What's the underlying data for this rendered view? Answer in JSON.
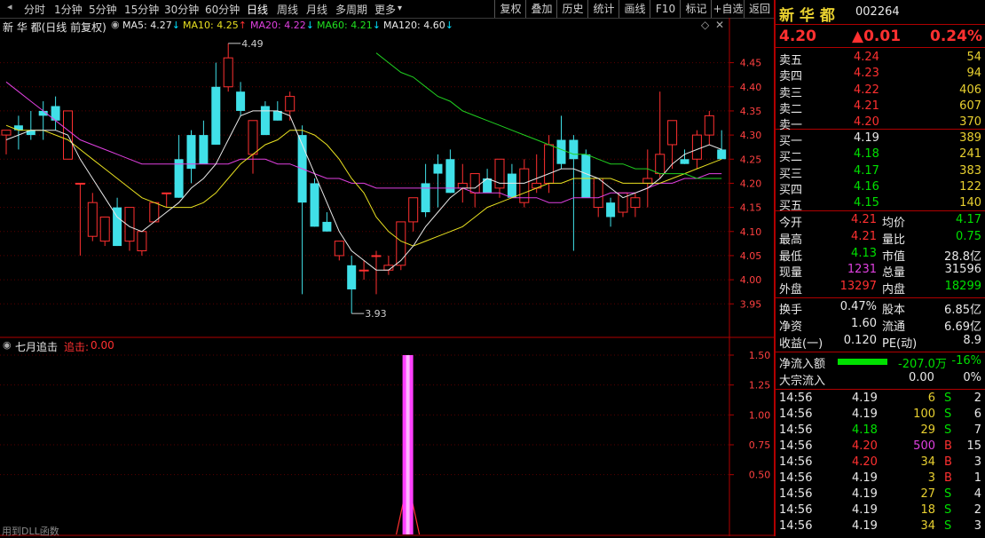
{
  "toolbar": {
    "periods": [
      "分时",
      "1分钟",
      "5分钟",
      "15分钟",
      "30分钟",
      "60分钟",
      "日线",
      "周线",
      "月线",
      "多周期",
      "更多"
    ],
    "active_period": "日线",
    "more_arrow": "▾",
    "right_buttons": [
      "复权",
      "叠加",
      "历史",
      "统计",
      "画线",
      "F10",
      "标记",
      "+自选",
      "返回"
    ]
  },
  "main_chart": {
    "title": "新 华 都(日线 前复权)",
    "ma_labels": [
      {
        "text": "MA5: 4.27",
        "arrow": "↓",
        "color": "#e8e8e8"
      },
      {
        "text": "MA10: 4.25",
        "arrow": "↑",
        "color": "#e8e020"
      },
      {
        "text": "MA20: 4.22",
        "arrow": "↓",
        "color": "#e040e0"
      },
      {
        "text": "MA60: 4.21",
        "arrow": "↓",
        "color": "#20e020"
      },
      {
        "text": "MA120: 4.60",
        "arrow": "↓",
        "color": "#e8e8e8"
      }
    ],
    "high_marker": "4.49",
    "low_marker": "3.93",
    "price_ticks": [
      "4.45",
      "4.40",
      "4.35",
      "4.30",
      "4.25",
      "4.20",
      "4.15",
      "4.10",
      "4.05",
      "4.00",
      "3.95"
    ]
  },
  "chart_data": {
    "type": "candlestick",
    "ylim": [
      3.91,
      4.51
    ],
    "candles": [
      [
        4.3,
        4.31,
        4.26,
        4.31
      ],
      [
        4.32,
        4.34,
        4.27,
        4.31
      ],
      [
        4.31,
        4.35,
        4.29,
        4.3
      ],
      [
        4.35,
        4.37,
        4.29,
        4.34
      ],
      [
        4.36,
        4.38,
        4.31,
        4.33
      ],
      [
        4.25,
        4.35,
        4.25,
        4.35
      ],
      [
        4.2,
        4.2,
        4.05,
        4.2
      ],
      [
        4.09,
        4.18,
        4.08,
        4.16
      ],
      [
        4.08,
        4.12,
        4.07,
        4.13
      ],
      [
        4.15,
        4.17,
        4.07,
        4.07
      ],
      [
        4.08,
        4.13,
        4.06,
        4.15
      ],
      [
        4.06,
        4.1,
        4.05,
        4.1
      ],
      [
        4.12,
        4.16,
        4.12,
        4.16
      ],
      [
        4.18,
        4.18,
        4.15,
        4.18
      ],
      [
        4.25,
        4.3,
        4.17,
        4.17
      ],
      [
        4.3,
        4.31,
        4.2,
        4.23
      ],
      [
        4.3,
        4.33,
        4.24,
        4.24
      ],
      [
        4.4,
        4.45,
        4.28,
        4.28
      ],
      [
        4.4,
        4.49,
        4.39,
        4.46
      ],
      [
        4.39,
        4.41,
        4.34,
        4.35
      ],
      [
        4.26,
        4.33,
        4.22,
        4.33
      ],
      [
        4.36,
        4.37,
        4.3,
        4.3
      ],
      [
        4.35,
        4.37,
        4.33,
        4.33
      ],
      [
        4.35,
        4.39,
        4.33,
        4.38
      ],
      [
        4.3,
        4.32,
        3.97,
        4.16
      ],
      [
        4.2,
        4.21,
        4.11,
        4.11
      ],
      [
        4.12,
        4.14,
        4.1,
        4.1
      ],
      [
        4.05,
        4.08,
        4.04,
        4.08
      ],
      [
        4.03,
        4.05,
        3.93,
        3.98
      ],
      [
        4.02,
        4.04,
        4.0,
        4.02
      ],
      [
        4.05,
        4.06,
        3.97,
        4.05
      ],
      [
        4.02,
        4.05,
        4.01,
        4.03
      ],
      [
        4.03,
        4.11,
        4.02,
        4.12
      ],
      [
        4.12,
        4.17,
        4.1,
        4.17
      ],
      [
        4.2,
        4.24,
        4.13,
        4.14
      ],
      [
        4.24,
        4.26,
        4.15,
        4.22
      ],
      [
        4.25,
        4.27,
        4.18,
        4.18
      ],
      [
        4.19,
        4.24,
        4.16,
        4.2
      ],
      [
        4.18,
        4.22,
        4.15,
        4.22
      ],
      [
        4.21,
        4.23,
        4.18,
        4.18
      ],
      [
        4.19,
        4.25,
        4.17,
        4.25
      ],
      [
        4.22,
        4.24,
        4.17,
        4.17
      ],
      [
        4.16,
        4.25,
        4.15,
        4.23
      ],
      [
        4.19,
        4.26,
        4.18,
        4.2
      ],
      [
        4.2,
        4.3,
        4.18,
        4.28
      ],
      [
        4.29,
        4.34,
        4.23,
        4.24
      ],
      [
        4.29,
        4.3,
        4.06,
        4.25
      ],
      [
        4.26,
        4.27,
        4.17,
        4.17
      ],
      [
        4.15,
        4.18,
        4.13,
        4.21
      ],
      [
        4.16,
        4.17,
        4.11,
        4.13
      ],
      [
        4.14,
        4.18,
        4.13,
        4.18
      ],
      [
        4.15,
        4.18,
        4.13,
        4.17
      ],
      [
        4.2,
        4.27,
        4.15,
        4.21
      ],
      [
        4.22,
        4.39,
        4.21,
        4.26
      ],
      [
        4.28,
        4.33,
        4.23,
        4.33
      ],
      [
        4.25,
        4.27,
        4.24,
        4.24
      ],
      [
        4.25,
        4.31,
        4.23,
        4.3
      ],
      [
        4.3,
        4.35,
        4.28,
        4.34
      ],
      [
        4.27,
        4.31,
        4.26,
        4.25
      ]
    ],
    "ma5": [
      4.29,
      4.3,
      4.31,
      4.31,
      4.31,
      4.3,
      4.25,
      4.21,
      4.17,
      4.13,
      4.11,
      4.1,
      4.12,
      4.14,
      4.16,
      4.19,
      4.21,
      4.24,
      4.29,
      4.34,
      4.35,
      4.35,
      4.35,
      4.34,
      4.28,
      4.22,
      4.16,
      4.1,
      4.06,
      4.04,
      4.02,
      4.02,
      4.04,
      4.07,
      4.11,
      4.14,
      4.17,
      4.19,
      4.19,
      4.21,
      4.2,
      4.2,
      4.2,
      4.21,
      4.22,
      4.23,
      4.23,
      4.22,
      4.21,
      4.19,
      4.17,
      4.18,
      4.19,
      4.21,
      4.24,
      4.26,
      4.27,
      4.28,
      4.27
    ],
    "ma10": [
      4.32,
      4.31,
      4.31,
      4.31,
      4.3,
      4.29,
      4.27,
      4.25,
      4.23,
      4.21,
      4.19,
      4.17,
      4.16,
      4.15,
      4.15,
      4.15,
      4.16,
      4.18,
      4.21,
      4.24,
      4.26,
      4.28,
      4.29,
      4.31,
      4.31,
      4.3,
      4.28,
      4.25,
      4.21,
      4.18,
      4.13,
      4.1,
      4.08,
      4.07,
      4.08,
      4.09,
      4.1,
      4.11,
      4.13,
      4.15,
      4.16,
      4.17,
      4.18,
      4.19,
      4.2,
      4.2,
      4.21,
      4.21,
      4.21,
      4.21,
      4.2,
      4.2,
      4.2,
      4.2,
      4.21,
      4.22,
      4.23,
      4.24,
      4.25
    ],
    "ma20": [
      4.41,
      4.39,
      4.37,
      4.35,
      4.33,
      4.31,
      4.29,
      4.28,
      4.27,
      4.26,
      4.25,
      4.24,
      4.24,
      4.24,
      4.24,
      4.24,
      4.24,
      4.24,
      4.24,
      4.25,
      4.25,
      4.25,
      4.24,
      4.24,
      4.23,
      4.22,
      4.21,
      4.21,
      4.2,
      4.2,
      4.19,
      4.19,
      4.19,
      4.19,
      4.19,
      4.19,
      4.19,
      4.19,
      4.18,
      4.18,
      4.18,
      4.17,
      4.17,
      4.17,
      4.16,
      4.16,
      4.17,
      4.17,
      4.17,
      4.18,
      4.18,
      4.18,
      4.19,
      4.2,
      4.2,
      4.21,
      4.21,
      4.22,
      4.22
    ],
    "ma60": [
      null,
      null,
      null,
      null,
      null,
      null,
      null,
      null,
      null,
      null,
      null,
      null,
      null,
      null,
      null,
      null,
      null,
      null,
      null,
      null,
      null,
      null,
      null,
      null,
      null,
      null,
      null,
      null,
      null,
      null,
      4.47,
      4.45,
      4.43,
      4.42,
      4.4,
      4.38,
      4.37,
      4.35,
      4.34,
      4.33,
      4.32,
      4.31,
      4.3,
      4.29,
      4.28,
      4.27,
      4.26,
      4.26,
      4.25,
      4.24,
      4.24,
      4.23,
      4.23,
      4.22,
      4.22,
      4.22,
      4.21,
      4.21,
      4.21
    ],
    "indicator": {
      "title": "七月追击",
      "label": "追击:",
      "value": "0.00",
      "yticks": [
        "1.50",
        "1.25",
        "1.00",
        "0.75",
        "0.50"
      ],
      "ylim": [
        0,
        1.5
      ],
      "spike_index": 34,
      "spike_value": 1.5,
      "footer": "用到DLL函数"
    }
  },
  "stock": {
    "name": "新 华 都",
    "code": "002264",
    "price": "4.20",
    "change": "▲0.01",
    "change_pct": "0.24%",
    "asks": [
      {
        "label": "卖五",
        "price": "4.24",
        "vol": "54"
      },
      {
        "label": "卖四",
        "price": "4.23",
        "vol": "94"
      },
      {
        "label": "卖三",
        "price": "4.22",
        "vol": "406"
      },
      {
        "label": "卖二",
        "price": "4.21",
        "vol": "607"
      },
      {
        "label": "卖一",
        "price": "4.20",
        "vol": "370"
      }
    ],
    "bids": [
      {
        "label": "买一",
        "price": "4.19",
        "vol": "389",
        "color": "#e8e8e8"
      },
      {
        "label": "买二",
        "price": "4.18",
        "vol": "241",
        "color": "#00e000"
      },
      {
        "label": "买三",
        "price": "4.17",
        "vol": "383",
        "color": "#00e000"
      },
      {
        "label": "买四",
        "price": "4.16",
        "vol": "122",
        "color": "#00e000"
      },
      {
        "label": "买五",
        "price": "4.15",
        "vol": "140",
        "color": "#00e000"
      }
    ],
    "stats": [
      {
        "l1": "今开",
        "v1": "4.21",
        "c1": "#ff3030",
        "l2": "均价",
        "v2": "4.17",
        "c2": "#00e000"
      },
      {
        "l1": "最高",
        "v1": "4.21",
        "c1": "#ff3030",
        "l2": "量比",
        "v2": "0.75",
        "c2": "#00e000"
      },
      {
        "l1": "最低",
        "v1": "4.13",
        "c1": "#00e000",
        "l2": "市值",
        "v2": "28.8亿",
        "c2": "#e8e8e8"
      },
      {
        "l1": "现量",
        "v1": "1231",
        "c1": "#e040e0",
        "l2": "总量",
        "v2": "31596",
        "c2": "#e8e8e8"
      },
      {
        "l1": "外盘",
        "v1": "13297",
        "c1": "#ff3030",
        "l2": "内盘",
        "v2": "18299",
        "c2": "#00e000"
      }
    ],
    "fin": [
      {
        "l1": "换手",
        "v1": "0.47%",
        "l2": "股本",
        "v2": "6.85亿"
      },
      {
        "l1": "净资",
        "v1": "1.60",
        "l2": "流通",
        "v2": "6.69亿"
      },
      {
        "l1": "收益(一)",
        "v1": "0.120",
        "l2": "PE(动)",
        "v2": "8.9"
      }
    ],
    "flow": {
      "label": "净流入额",
      "value": "-207.0万",
      "pct": "-16%",
      "bar_fraction": 0.7
    },
    "block": {
      "label": "大宗流入",
      "value": "0.00",
      "pct": "0%"
    },
    "ticks": [
      {
        "time": "14:56",
        "price": "4.19",
        "pc": "#e8e8e8",
        "vol": "6",
        "vc": "#e8d030",
        "side": "S",
        "n": "2"
      },
      {
        "time": "14:56",
        "price": "4.19",
        "pc": "#e8e8e8",
        "vol": "100",
        "vc": "#e8d030",
        "side": "S",
        "n": "6"
      },
      {
        "time": "14:56",
        "price": "4.18",
        "pc": "#00e000",
        "vol": "29",
        "vc": "#e8d030",
        "side": "S",
        "n": "7"
      },
      {
        "time": "14:56",
        "price": "4.20",
        "pc": "#ff3030",
        "vol": "500",
        "vc": "#e040e0",
        "side": "B",
        "n": "15"
      },
      {
        "time": "14:56",
        "price": "4.20",
        "pc": "#ff3030",
        "vol": "34",
        "vc": "#e8d030",
        "side": "B",
        "n": "3"
      },
      {
        "time": "14:56",
        "price": "4.19",
        "pc": "#e8e8e8",
        "vol": "3",
        "vc": "#e8d030",
        "side": "B",
        "n": "1"
      },
      {
        "time": "14:56",
        "price": "4.19",
        "pc": "#e8e8e8",
        "vol": "27",
        "vc": "#e8d030",
        "side": "S",
        "n": "4"
      },
      {
        "time": "14:56",
        "price": "4.19",
        "pc": "#e8e8e8",
        "vol": "18",
        "vc": "#e8d030",
        "side": "S",
        "n": "2"
      },
      {
        "time": "14:56",
        "price": "4.19",
        "pc": "#e8e8e8",
        "vol": "34",
        "vc": "#e8d030",
        "side": "S",
        "n": "3"
      }
    ]
  }
}
